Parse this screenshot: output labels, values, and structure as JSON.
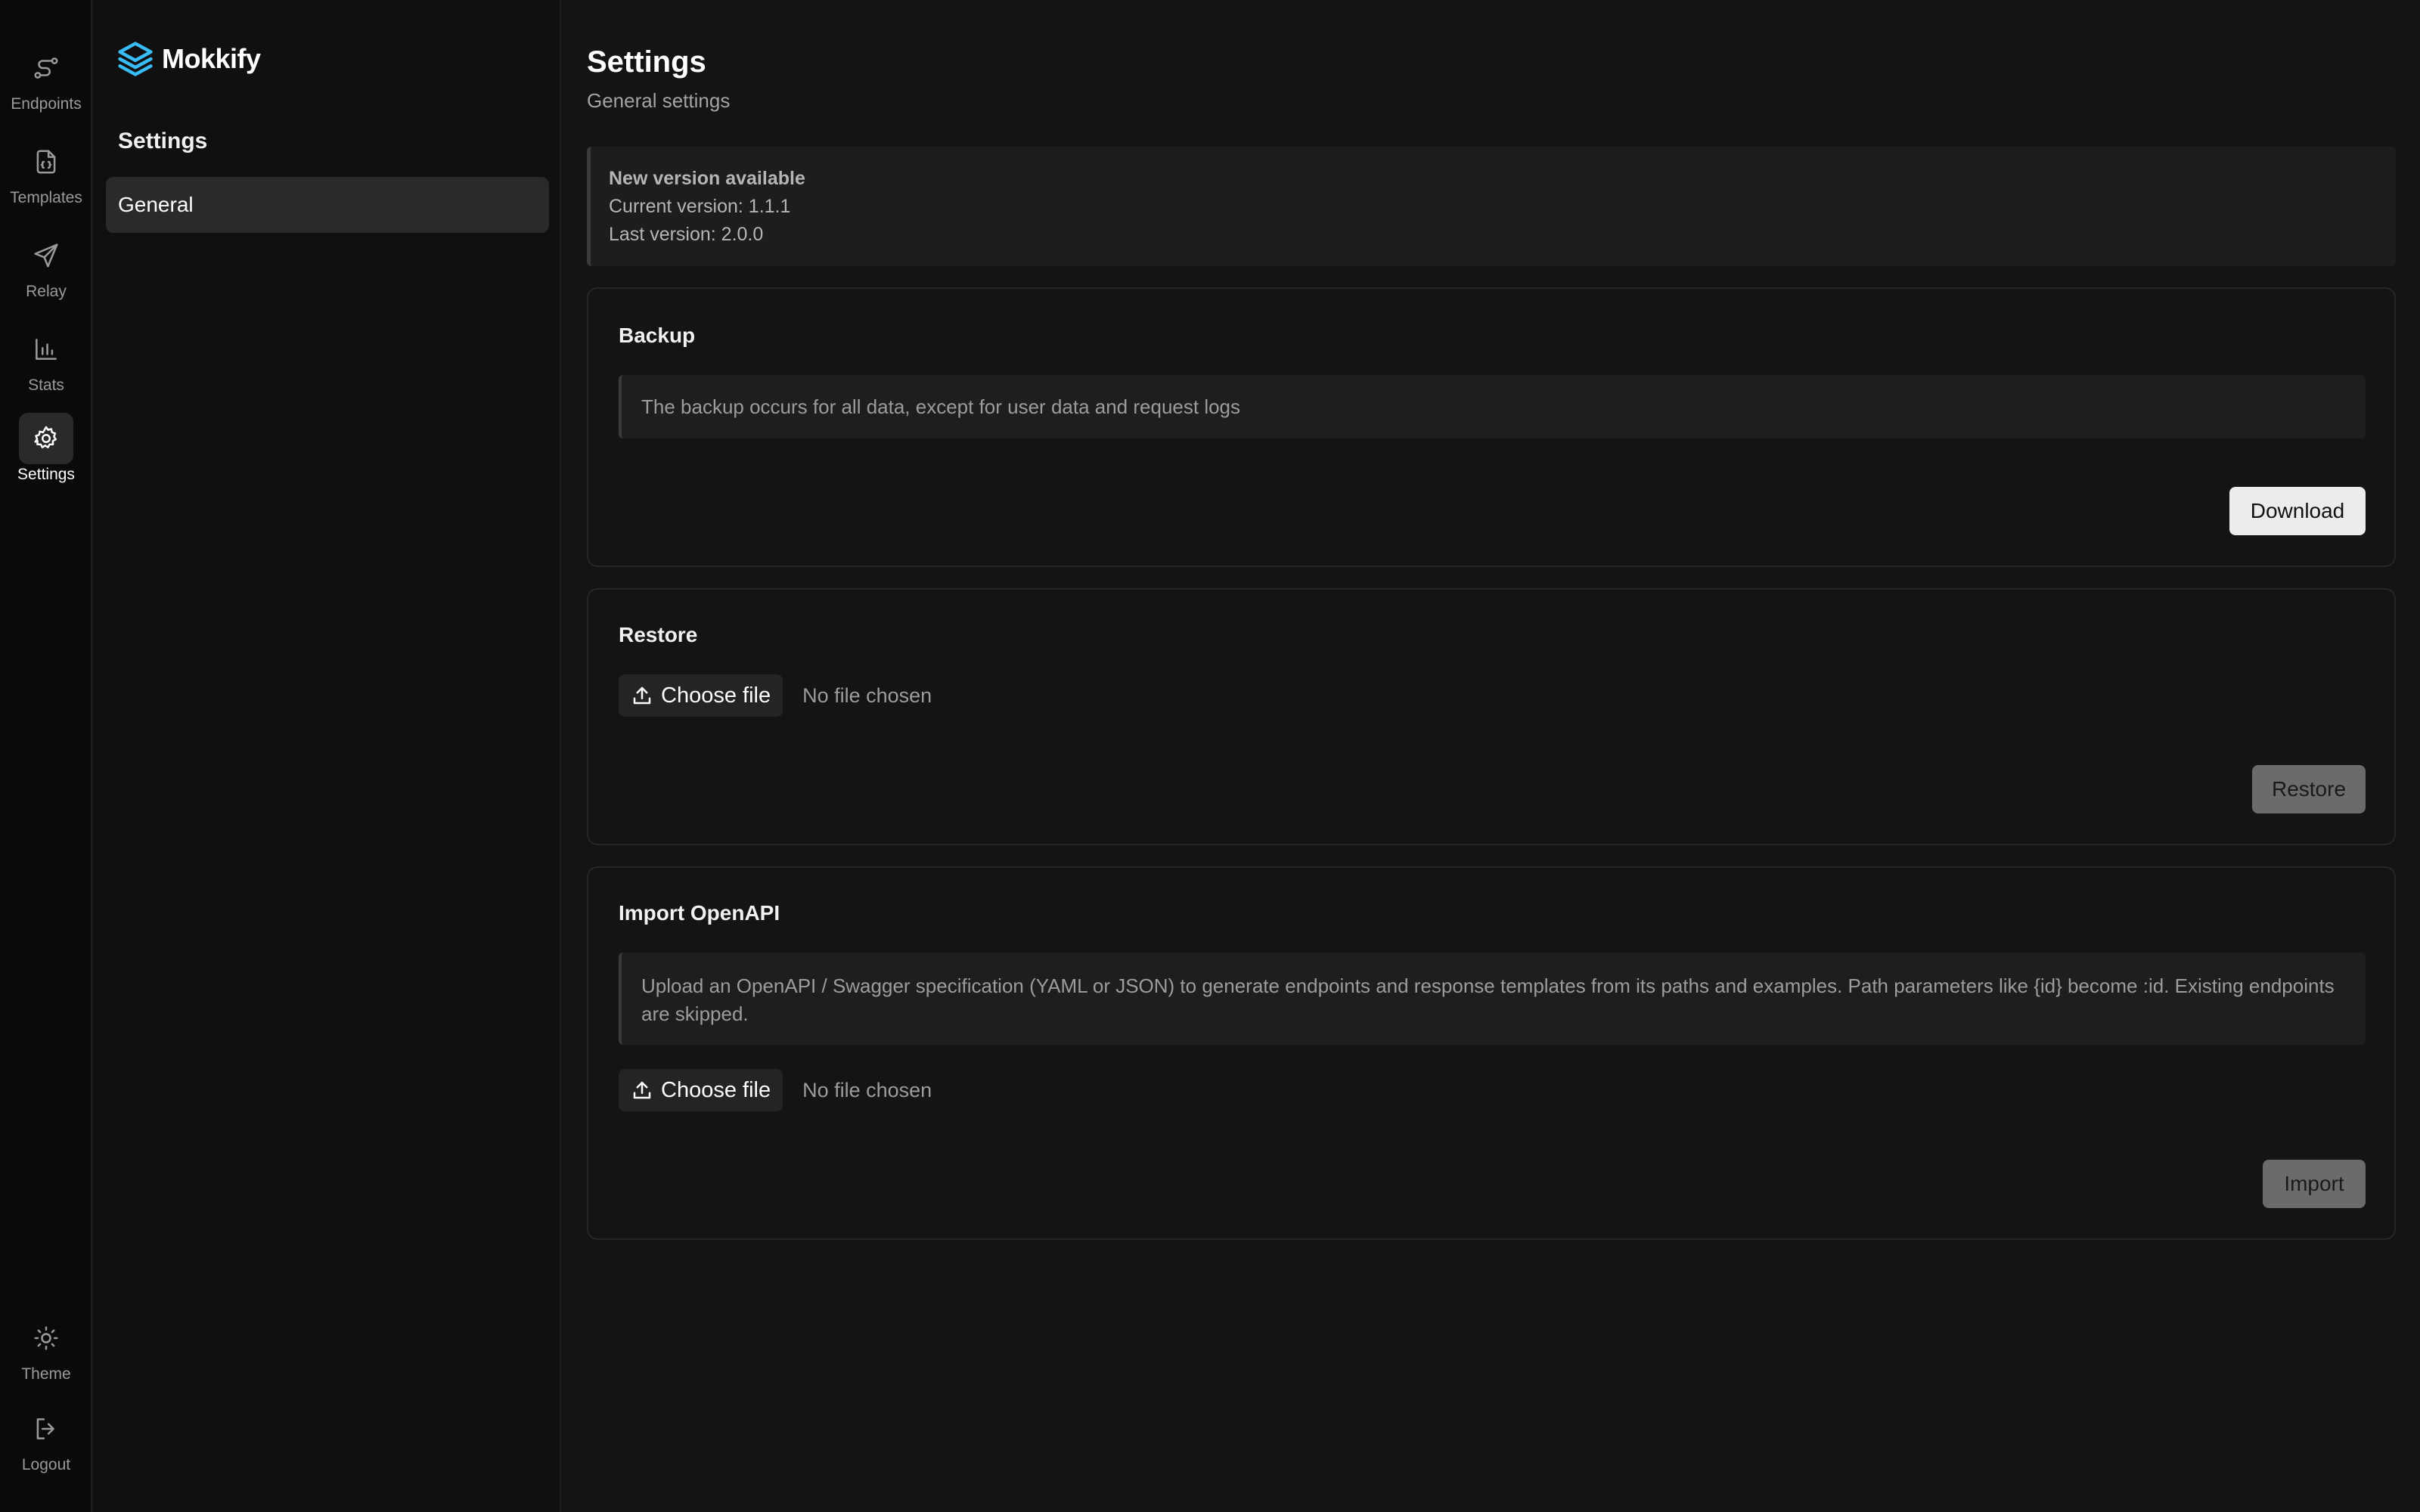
{
  "rail": {
    "items": [
      {
        "label": "Endpoints",
        "icon": "route-icon",
        "active": false
      },
      {
        "label": "Templates",
        "icon": "file-braces-icon",
        "active": false
      },
      {
        "label": "Relay",
        "icon": "send-icon",
        "active": false
      },
      {
        "label": "Stats",
        "icon": "bar-chart-icon",
        "active": false
      },
      {
        "label": "Settings",
        "icon": "gear-icon",
        "active": true
      }
    ],
    "bottom": [
      {
        "label": "Theme",
        "icon": "sun-icon"
      },
      {
        "label": "Logout",
        "icon": "logout-icon"
      }
    ]
  },
  "brand": {
    "name": "Mokkify",
    "accent": "#38bdf8"
  },
  "sidebar": {
    "title": "Settings",
    "items": [
      {
        "label": "General",
        "active": true
      }
    ]
  },
  "page": {
    "title": "Settings",
    "subtitle": "General settings"
  },
  "update_notice": {
    "title": "New version available",
    "current": "Current version: 1.1.1",
    "last": "Last version: 2.0.0"
  },
  "backup": {
    "title": "Backup",
    "info": "The backup occurs for all data, except for user data and request logs",
    "button": "Download"
  },
  "restore": {
    "title": "Restore",
    "choose_label": "Choose file",
    "no_file": "No file chosen",
    "button": "Restore"
  },
  "import_openapi": {
    "title": "Import OpenAPI",
    "info": "Upload an OpenAPI / Swagger specification (YAML or JSON) to generate endpoints and response templates from its paths and examples. Path parameters like {id} become :id. Existing endpoints are skipped.",
    "choose_label": "Choose file",
    "no_file": "No file chosen",
    "button": "Import"
  }
}
